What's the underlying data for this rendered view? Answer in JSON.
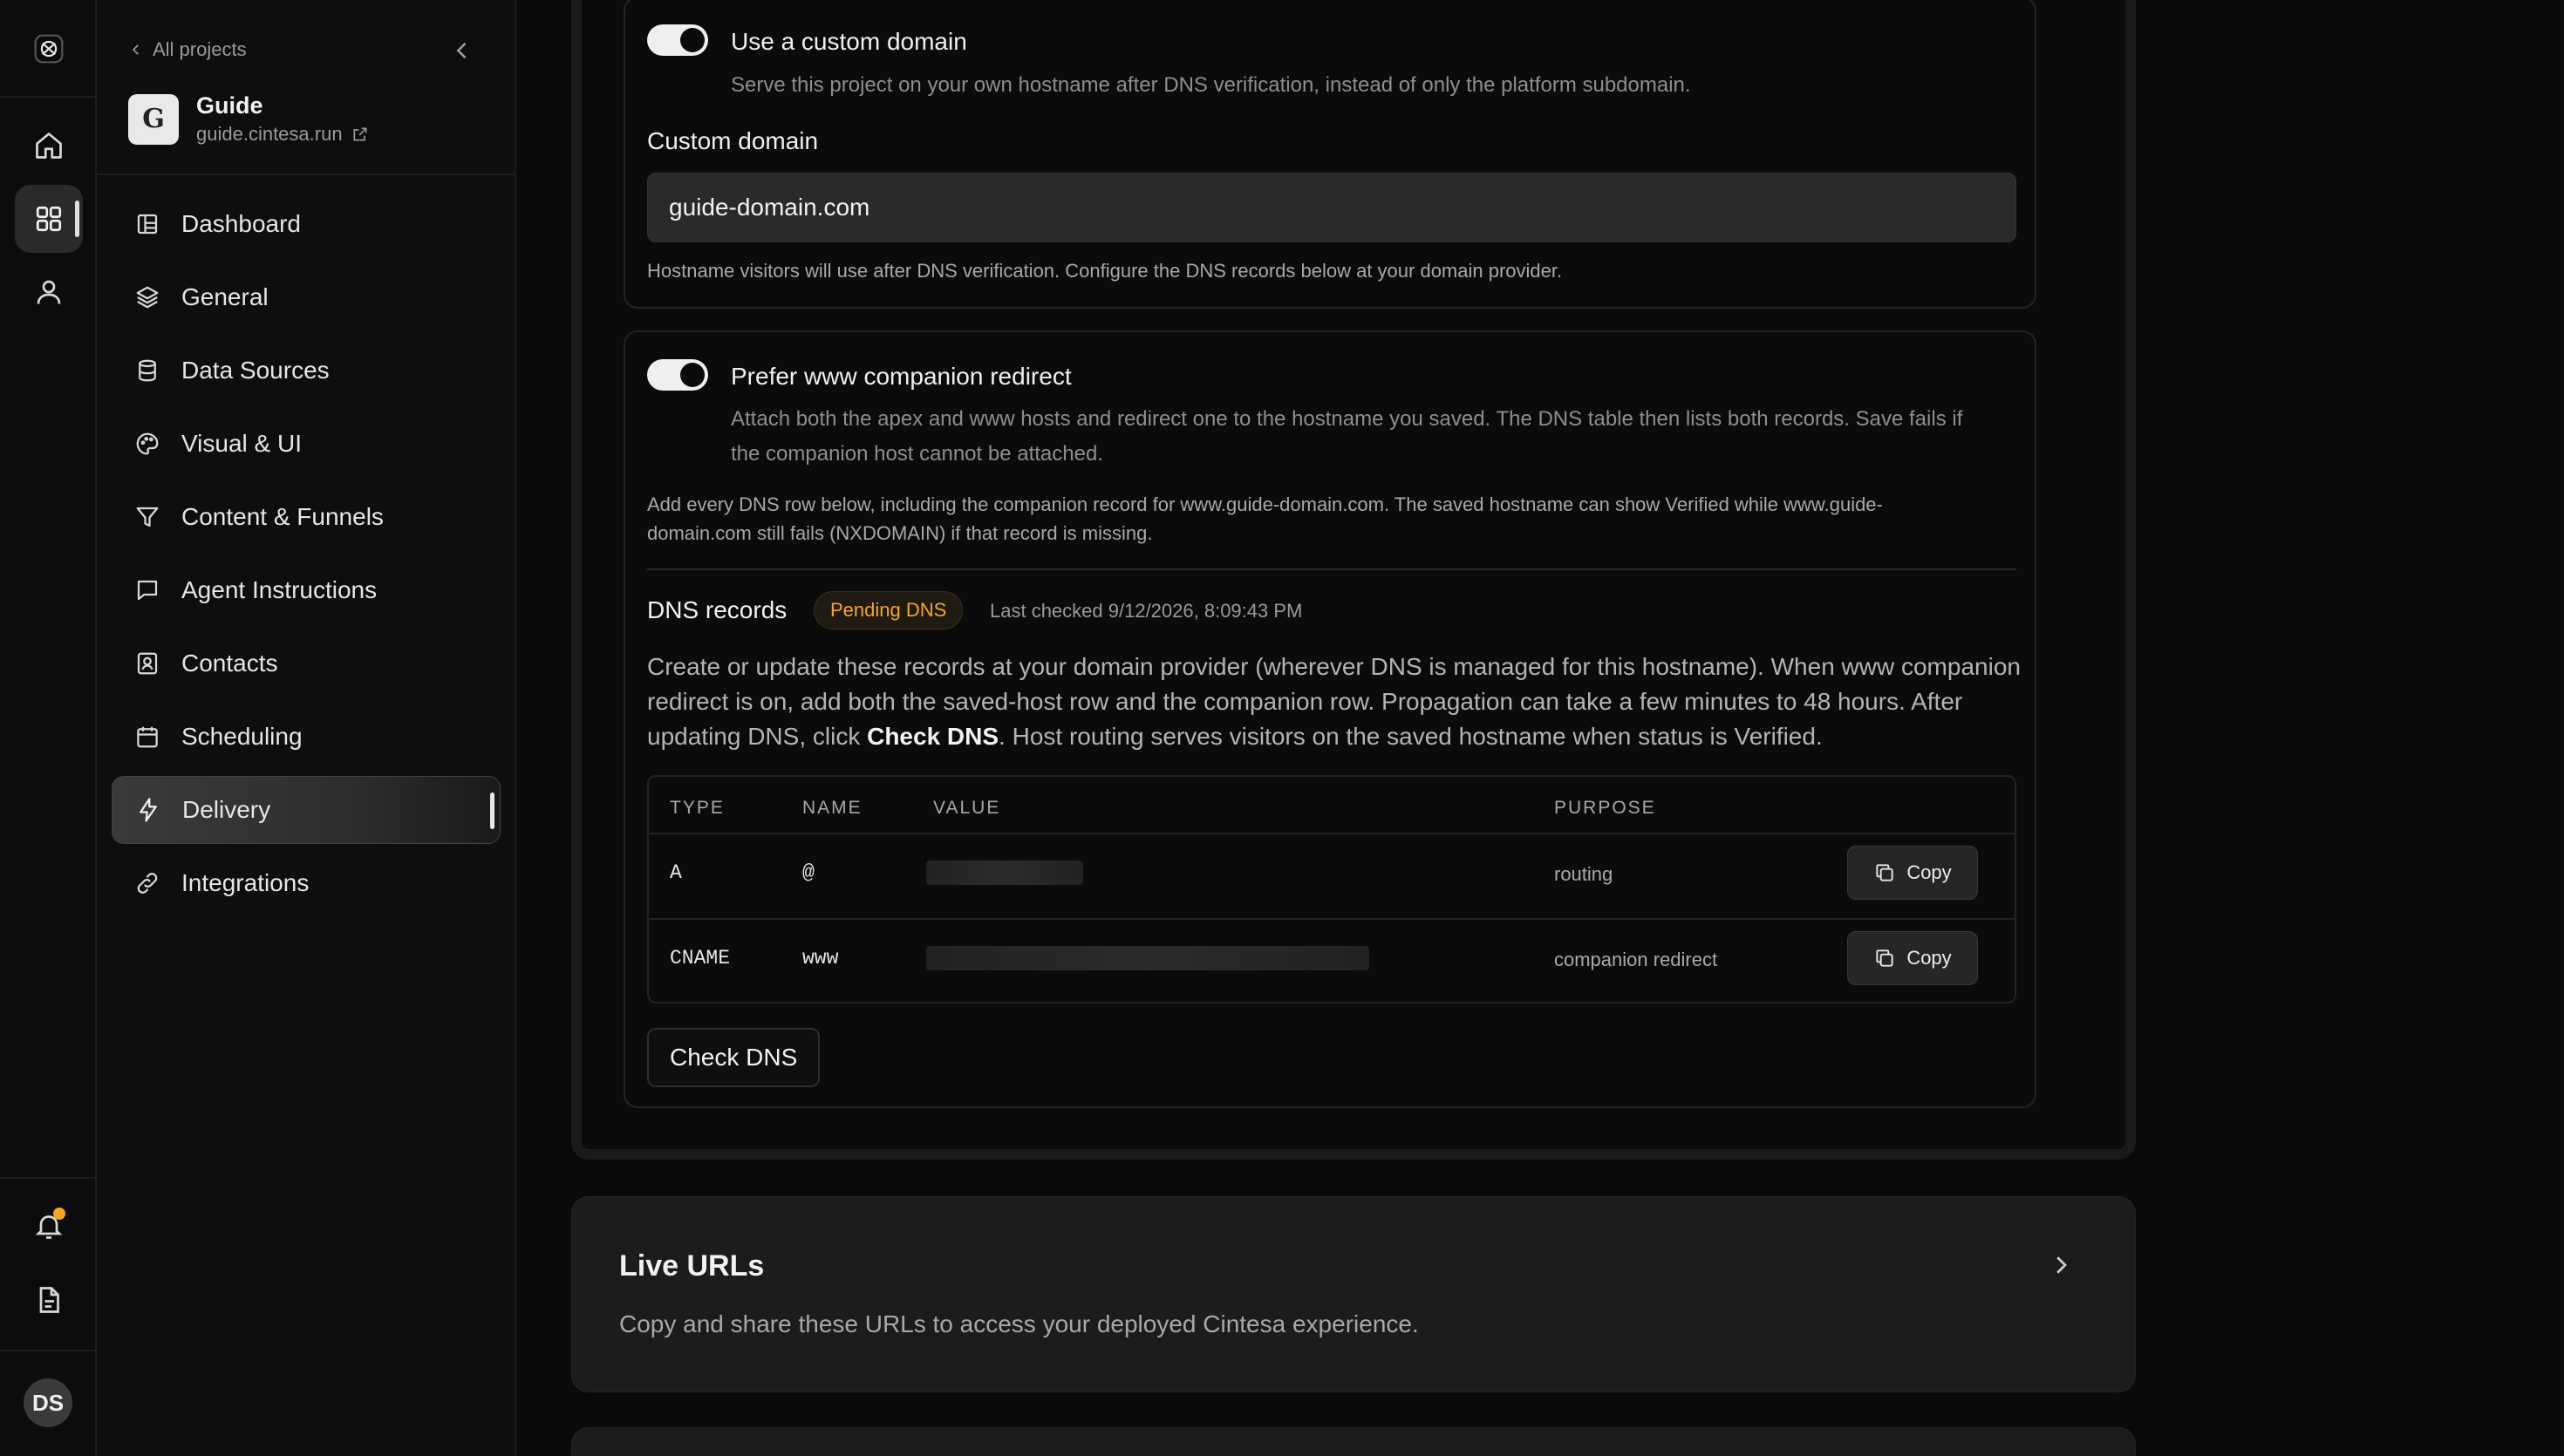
{
  "sidebar": {
    "back_label": "All projects",
    "project": {
      "logo_text": "G",
      "name": "Guide",
      "url": "guide.cintesa.run"
    },
    "items": [
      {
        "label": "Dashboard"
      },
      {
        "label": "General"
      },
      {
        "label": "Data Sources"
      },
      {
        "label": "Visual & UI"
      },
      {
        "label": "Content & Funnels"
      },
      {
        "label": "Agent Instructions"
      },
      {
        "label": "Contacts"
      },
      {
        "label": "Scheduling"
      },
      {
        "label": "Delivery",
        "active": true
      },
      {
        "label": "Integrations"
      }
    ]
  },
  "rail": {
    "user_initials": "DS",
    "notification_color": "#f5a524"
  },
  "custom_domain": {
    "toggle_label": "Use a custom domain",
    "toggle_on": true,
    "toggle_desc": "Serve this project on your own hostname after DNS verification, instead of only the platform subdomain.",
    "field_label": "Custom domain",
    "field_value": "guide-domain.com",
    "hint": "Hostname visitors will use after DNS verification. Configure the DNS records below at your domain provider."
  },
  "www_redirect": {
    "toggle_label": "Prefer www companion redirect",
    "toggle_on": true,
    "desc_line1": "Attach both the apex and www hosts and redirect one to the hostname you saved. The DNS table then lists both records. Save fails if",
    "desc_line2": "the companion host cannot be attached.",
    "note_line1": "Add every DNS row below, including the companion record for www.guide-domain.com. The saved hostname can show Verified while www.guide-",
    "note_line2": "domain.com still fails (NXDOMAIN) if that record is missing."
  },
  "dns": {
    "title": "DNS records",
    "status_badge": "Pending DNS",
    "status_color": "#f5a524",
    "last_checked": "Last checked 9/12/2026, 8:09:43 PM",
    "desc_part1": "Create or update these records at your domain provider (wherever DNS is managed for this hostname). When www companion redirect is on, add both the saved-host row and the companion row. Propagation can take a few minutes to 48 hours. After updating DNS, click ",
    "desc_bold": "Check DNS",
    "desc_part2": ". Host routing serves visitors on the saved hostname when status is Verified.",
    "columns": [
      "TYPE",
      "NAME",
      "VALUE",
      "PURPOSE"
    ],
    "rows": [
      {
        "type": "A",
        "name": "@",
        "purpose": "routing",
        "copy_label": "Copy"
      },
      {
        "type": "CNAME",
        "name": "www",
        "purpose": "companion redirect",
        "copy_label": "Copy"
      }
    ],
    "check_button": "Check DNS"
  },
  "live_urls": {
    "title": "Live URLs",
    "desc": "Copy and share these URLs to access your deployed Cintesa experience."
  }
}
